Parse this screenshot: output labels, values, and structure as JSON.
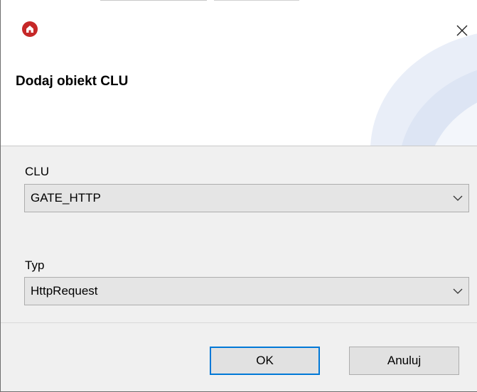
{
  "window": {
    "title": "Dodaj obiekt CLU",
    "app_icon": "house-icon",
    "close_icon": "close-icon"
  },
  "form": {
    "clu": {
      "label": "CLU",
      "value": "GATE_HTTP"
    },
    "typ": {
      "label": "Typ",
      "value": "HttpRequest"
    }
  },
  "buttons": {
    "ok_label": "OK",
    "cancel_label": "Anuluj"
  },
  "colors": {
    "icon_red": "#c62828",
    "default_button_border": "#0078d7",
    "dialog_background": "#f0f0f0"
  }
}
